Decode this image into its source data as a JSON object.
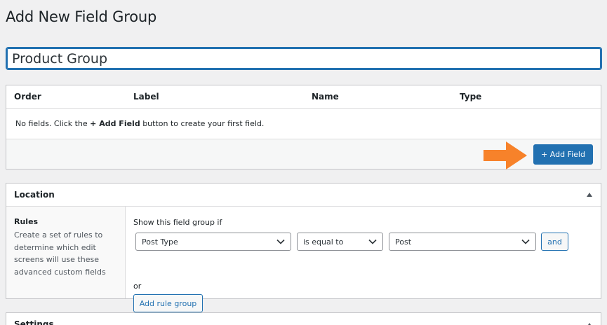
{
  "page": {
    "title": "Add New Field Group"
  },
  "title_input": {
    "value": "Product Group"
  },
  "fields_table": {
    "columns": [
      "Order",
      "Label",
      "Name",
      "Type"
    ],
    "empty_message": {
      "before": "No fields. Click the ",
      "emphasis": "+ Add Field",
      "after": " button to create your first field."
    },
    "add_button": "+ Add Field"
  },
  "annotation": {
    "arrow_color": "#f7822a",
    "arrow_icon": "arrow-right-icon"
  },
  "location": {
    "title": "Location",
    "rules_title": "Rules",
    "rules_description": "Create a set of rules to determine which edit screens will use these advanced custom fields",
    "show_if": "Show this field group if",
    "param_select": "Post Type",
    "operator_select": "is equal to",
    "value_select": "Post",
    "and_button": "and",
    "or_label": "or",
    "add_rule_group": "Add rule group"
  },
  "settings": {
    "title": "Settings"
  },
  "colors": {
    "accent": "#2271b1",
    "background": "#f0f0f1"
  }
}
